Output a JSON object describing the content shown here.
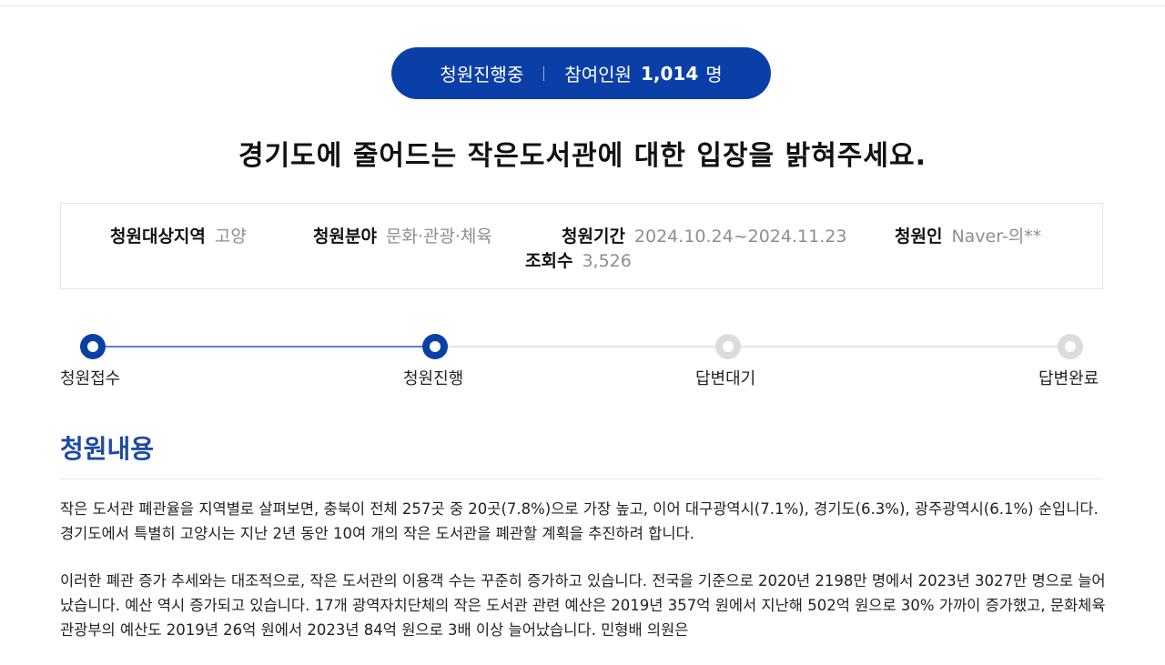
{
  "status": {
    "state": "청원진행중",
    "participants_label": "참여인원",
    "participants_count": "1,014",
    "participants_unit": "명"
  },
  "title": "경기도에 줄어드는 작은도서관에 대한 입장을 밝혀주세요.",
  "info": {
    "region_label": "청원대상지역",
    "region_value": "고양",
    "field_label": "청원분야",
    "field_value": "문화·관광·체육",
    "period_label": "청원기간",
    "period_value": "2024.10.24~2024.11.23",
    "petitioner_label": "청원인",
    "petitioner_value": "Naver-의**",
    "views_label": "조회수",
    "views_value": "3,526"
  },
  "progress": {
    "steps": [
      {
        "label": "청원접수",
        "state": "done"
      },
      {
        "label": "청원진행",
        "state": "current"
      },
      {
        "label": "답변대기",
        "state": "pending"
      },
      {
        "label": "답변완료",
        "state": "pending"
      }
    ],
    "active_color": "#0b3fa8",
    "inactive_color": "#dcdcdc"
  },
  "section": {
    "heading": "청원내용",
    "paragraphs": [
      "작은 도서관 폐관율을 지역별로 살펴보면, 충북이 전체 257곳 중 20곳(7.8%)으로 가장 높고, 이어 대구광역시(7.1%), 경기도(6.3%), 광주광역시(6.1%) 순입니다. 경기도에서 특별히 고양시는 지난 2년 동안 10여 개의 작은 도서관을 폐관할 계획을 추진하려 합니다.",
      "이러한 폐관 증가 추세와는 대조적으로, 작은 도서관의 이용객 수는 꾸준히 증가하고 있습니다. 전국을 기준으로 2020년 2198만 명에서 2023년 3027만 명으로 늘어났습니다. 예산 역시 증가되고 있습니다. 17개 광역자치단체의 작은 도서관 관련 예산은 2019년 357억 원에서 지난해 502억 원으로 30% 가까이 증가했고, 문화체육관광부의 예산도 2019년 26억 원에서 2023년 84억 원으로 3배 이상 늘어났습니다. 민형배 의원은"
    ]
  },
  "colors": {
    "brand": "#0b3fa8",
    "heading": "#1d4aa5",
    "muted": "#8e8e8e"
  }
}
